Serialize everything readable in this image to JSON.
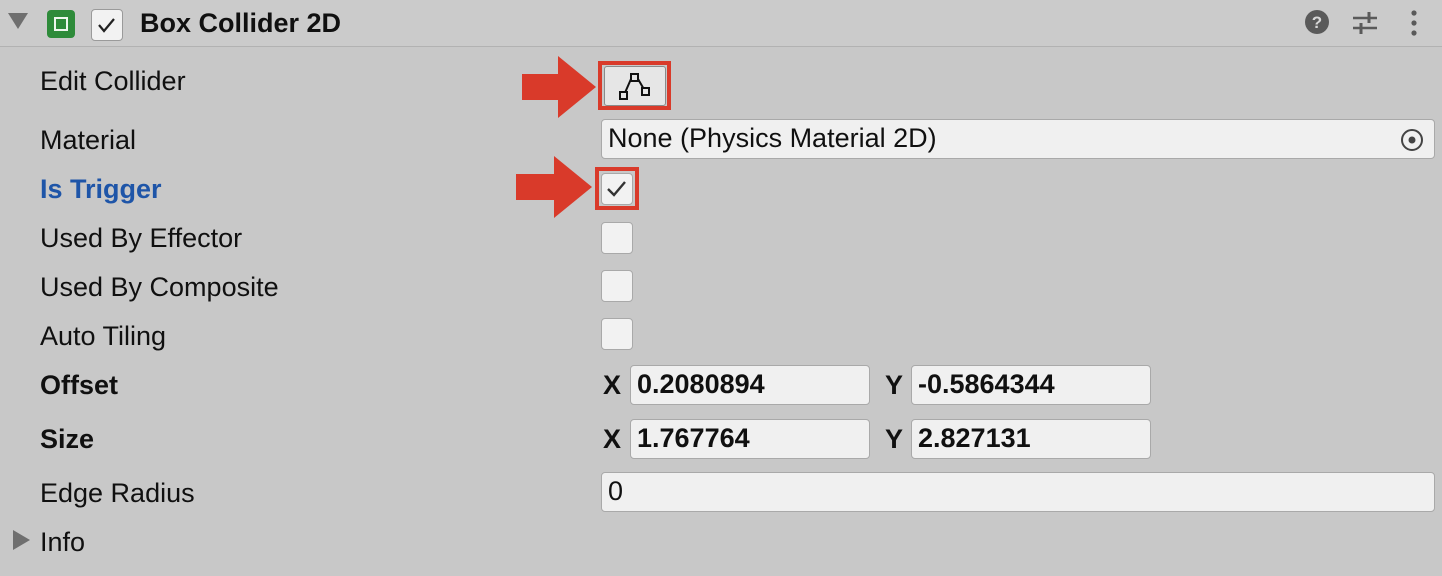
{
  "component": {
    "title": "Box Collider 2D"
  },
  "properties": {
    "edit_collider": "Edit Collider",
    "material": "Material",
    "material_value": "None (Physics Material 2D)",
    "is_trigger": "Is Trigger",
    "is_trigger_checked": true,
    "used_by_effector": "Used By Effector",
    "used_by_composite": "Used By Composite",
    "auto_tiling": "Auto Tiling",
    "offset": "Offset",
    "size": "Size",
    "edge_radius": "Edge Radius",
    "edge_radius_value": "0",
    "info": "Info"
  },
  "vectors": {
    "x_label": "X",
    "y_label": "Y",
    "offset_x": "0.2080894",
    "offset_y": "-0.5864344",
    "size_x": "1.767764",
    "size_y": "2.827131"
  },
  "icons": {
    "header": [
      "foldout-arrow-icon",
      "box-collider-icon",
      "enabled-checkbox",
      "help-icon",
      "presets-icon",
      "more-icon"
    ],
    "edit": "edit-collider-icon",
    "object_picker": "object-picker-icon"
  },
  "colors": {
    "background": "#c8c8c8",
    "highlight": "#d93a2a",
    "modified_label": "#1e55a8",
    "component_icon": "#2e8b3a"
  }
}
